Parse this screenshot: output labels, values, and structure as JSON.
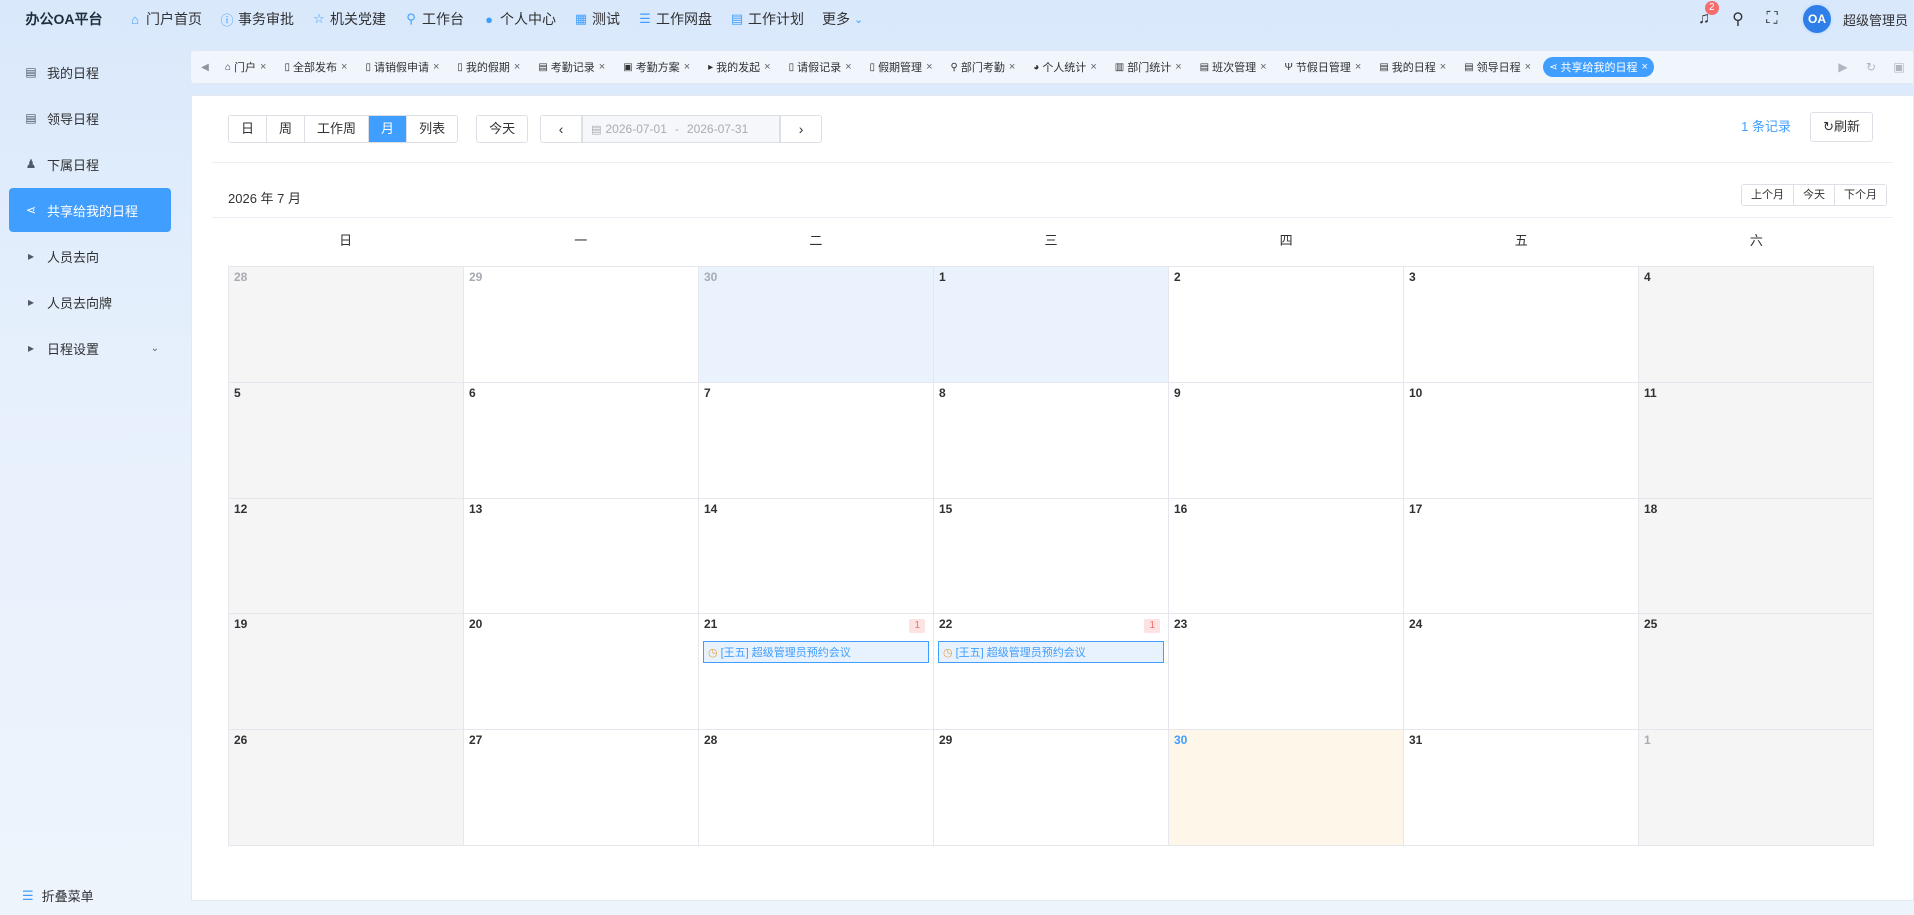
{
  "app": {
    "brand": "办公OA平台",
    "nav": [
      {
        "label": "门户首页",
        "icon": "home-icon",
        "glyph": "⌂"
      },
      {
        "label": "事务审批",
        "icon": "info-icon",
        "glyph": "ⓘ"
      },
      {
        "label": "机关党建",
        "icon": "star-icon",
        "glyph": "☆"
      },
      {
        "label": "工作台",
        "icon": "sitemap-icon",
        "glyph": "⚲"
      },
      {
        "label": "个人中心",
        "icon": "user-icon",
        "glyph": "●"
      },
      {
        "label": "测试",
        "icon": "gift-icon",
        "glyph": "▦"
      },
      {
        "label": "工作网盘",
        "icon": "database-icon",
        "glyph": "☰"
      },
      {
        "label": "工作计划",
        "icon": "calendar-icon",
        "glyph": "▤"
      }
    ],
    "more_label": "更多",
    "notification_count": "2",
    "avatar_text": "OA",
    "username": "超级管理员"
  },
  "sidebar": {
    "items": [
      {
        "label": "我的日程",
        "icon": "calendar-icon",
        "glyph": "▤"
      },
      {
        "label": "领导日程",
        "icon": "calendar-icon",
        "glyph": "▤"
      },
      {
        "label": "下属日程",
        "icon": "user-tie-icon",
        "glyph": "♟"
      },
      {
        "label": "共享给我的日程",
        "icon": "share-icon",
        "glyph": "⋖"
      },
      {
        "label": "人员去向",
        "icon": "caret-right-icon",
        "glyph": "▸"
      },
      {
        "label": "人员去向牌",
        "icon": "caret-right-icon",
        "glyph": "▸"
      },
      {
        "label": "日程设置",
        "icon": "caret-right-icon",
        "glyph": "▸"
      }
    ],
    "active_index": 3,
    "collapse_label": "折叠菜单"
  },
  "tabs": [
    {
      "label": "门户",
      "glyph": "⌂"
    },
    {
      "label": "全部发布",
      "glyph": "▯"
    },
    {
      "label": "请销假申请",
      "glyph": "▯"
    },
    {
      "label": "我的假期",
      "glyph": "▯"
    },
    {
      "label": "考勤记录",
      "glyph": "▤"
    },
    {
      "label": "考勤方案",
      "glyph": "▣"
    },
    {
      "label": "我的发起",
      "glyph": "▸"
    },
    {
      "label": "请假记录",
      "glyph": "▯"
    },
    {
      "label": "假期管理",
      "glyph": "▯"
    },
    {
      "label": "部门考勤",
      "glyph": "⚲"
    },
    {
      "label": "个人统计",
      "glyph": "◕"
    },
    {
      "label": "部门统计",
      "glyph": "▥"
    },
    {
      "label": "班次管理",
      "glyph": "▤"
    },
    {
      "label": "节假日管理",
      "glyph": "Ψ"
    },
    {
      "label": "我的日程",
      "glyph": "▤"
    },
    {
      "label": "领导日程",
      "glyph": "▤"
    },
    {
      "label": "共享给我的日程",
      "glyph": "⋖"
    }
  ],
  "active_tab_index": 16,
  "toolbar": {
    "views": [
      "日",
      "周",
      "工作周",
      "月",
      "列表"
    ],
    "active_view": "月",
    "today_label": "今天",
    "date_start": "2026-07-01",
    "date_sep": "-",
    "date_end": "2026-07-31",
    "records_label": "1 条记录",
    "refresh_label": "刷新"
  },
  "calendar": {
    "month_title": "2026 年 7 月",
    "month_nav": [
      "上个月",
      "今天",
      "下个月"
    ],
    "weekdays": [
      "日",
      "一",
      "二",
      "三",
      "四",
      "五",
      "六"
    ],
    "days": [
      {
        "d": "28",
        "other": true
      },
      {
        "d": "29",
        "other": true
      },
      {
        "d": "30",
        "other": true,
        "highlight": true
      },
      {
        "d": "1",
        "highlight": true
      },
      {
        "d": "2"
      },
      {
        "d": "3"
      },
      {
        "d": "4"
      },
      {
        "d": "5"
      },
      {
        "d": "6"
      },
      {
        "d": "7"
      },
      {
        "d": "8"
      },
      {
        "d": "9"
      },
      {
        "d": "10"
      },
      {
        "d": "11"
      },
      {
        "d": "12"
      },
      {
        "d": "13"
      },
      {
        "d": "14"
      },
      {
        "d": "15"
      },
      {
        "d": "16"
      },
      {
        "d": "17"
      },
      {
        "d": "18"
      },
      {
        "d": "19"
      },
      {
        "d": "20"
      },
      {
        "d": "21",
        "count": "1",
        "event": "[王五] 超级管理员预约会议"
      },
      {
        "d": "22",
        "count": "1",
        "event": "[王五] 超级管理员预约会议"
      },
      {
        "d": "23"
      },
      {
        "d": "24"
      },
      {
        "d": "25"
      },
      {
        "d": "26"
      },
      {
        "d": "27"
      },
      {
        "d": "28"
      },
      {
        "d": "29"
      },
      {
        "d": "30",
        "today": true
      },
      {
        "d": "31"
      },
      {
        "d": "1",
        "other": true
      }
    ]
  },
  "colors": {
    "accent": "#409eff",
    "today_bg": "#fdf6e9",
    "weekend_bg": "#f5f5f5",
    "highlight_bg": "#e9f2fd",
    "badge": "#f56c6c"
  }
}
